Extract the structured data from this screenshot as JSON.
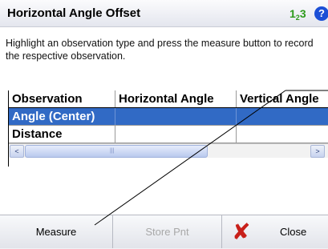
{
  "titlebar": {
    "title": "Horizontal Angle Offset",
    "input_mode": {
      "one": "1",
      "two": "2",
      "three": "3"
    },
    "help_glyph": "?"
  },
  "instruction": "Highlight an observation type and press the measure button to record the respective observation.",
  "table": {
    "columns": [
      "Observation",
      "Horizontal Angle",
      "Vertical Angle"
    ],
    "rows": [
      {
        "observation": "Angle (Center)",
        "horizontal": "",
        "vertical": "",
        "selected": true
      },
      {
        "observation": "Distance",
        "horizontal": "",
        "vertical": "",
        "selected": false
      }
    ]
  },
  "scrollbar": {
    "left_arrow": "<",
    "right_arrow": ">",
    "grip": "|||"
  },
  "buttons": {
    "measure": "Measure",
    "store": "Store Pnt",
    "close": "Close",
    "close_glyph": "✘"
  },
  "colors": {
    "selection": "#316ac5",
    "help_icon": "#1c4fd6",
    "input_mode": "#2e9a1c",
    "close_icon": "#c8201a"
  }
}
